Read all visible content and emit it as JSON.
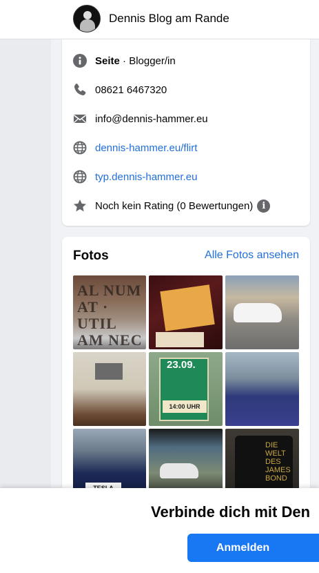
{
  "header": {
    "page_name": "Dennis Blog am Rande"
  },
  "intro": {
    "category_prefix": "Seite",
    "category_suffix": " · Blogger/in",
    "phone": "08621 6467320",
    "email": "info@dennis-hammer.eu",
    "website_1": "dennis-hammer.eu/flirt",
    "website_2": "typ.dennis-hammer.eu",
    "rating": "Noch kein Rating (0 Bewertungen)",
    "info_badge": "i"
  },
  "photos": {
    "title": "Fotos",
    "see_all": "Alle Fotos ansehen",
    "photo_texts": {
      "p1": "AL NUM AT · UTIL AM NEC OMMINI",
      "p5_date": "23.09.",
      "p5_time": "14:00 UHR",
      "p7_plate": "TESLA",
      "p9_title": "DIE WELT DES JAMES BOND"
    }
  },
  "bottom": {
    "heading": "Verbinde dich mit Den",
    "login_label": "Anmelden"
  },
  "colors": {
    "link": "#216fdb",
    "primary_button": "#1877f2",
    "icon_gray": "#65676b"
  }
}
